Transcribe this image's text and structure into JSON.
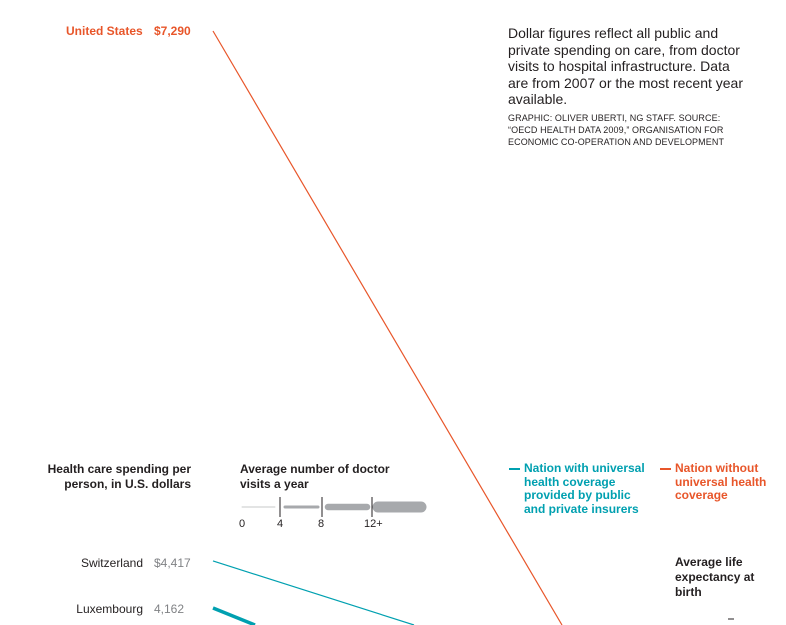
{
  "note": "Dollar figures reflect all public and private spending on care, from doctor visits to hospital infrastructure. Data are from 2007 or the most recent year available.",
  "credit": "GRAPHIC: OLIVER UBERTI, NG STAFF. SOURCE: “OECD HEALTH DATA 2009,” ORGANISATION FOR ECONOMIC CO-OPERATION AND DEVELOPMENT",
  "chart_data": {
    "type": "line",
    "spending_axis_label": "Health care spending per person, in U.S. dollars",
    "visits_legend": {
      "title": "Average number of doctor visits a year",
      "ticks": [
        "0",
        "4",
        "8",
        "12+"
      ]
    },
    "life_axis_label": "Average life expectancy at birth",
    "legend": [
      {
        "label": "Nation with universal health coverage provided by public and private insurers",
        "color": "#00a0b0"
      },
      {
        "label": "Nation without universal health coverage",
        "color": "#e8562a"
      }
    ],
    "countries": [
      {
        "name": "United States",
        "spending_label": "$7,290",
        "spending": 7290,
        "coverage": "without",
        "visits": 4
      },
      {
        "name": "Switzerland",
        "spending_label": "$4,417",
        "spending": 4417,
        "coverage": "universal",
        "visits": 4
      },
      {
        "name": "Luxembourg",
        "spending_label": "4,162",
        "spending": 4162,
        "coverage": "universal",
        "visits": 8
      }
    ]
  },
  "colors": {
    "universal": "#00a0b0",
    "without": "#e8562a",
    "visits_bar": "#a7a9ac"
  }
}
